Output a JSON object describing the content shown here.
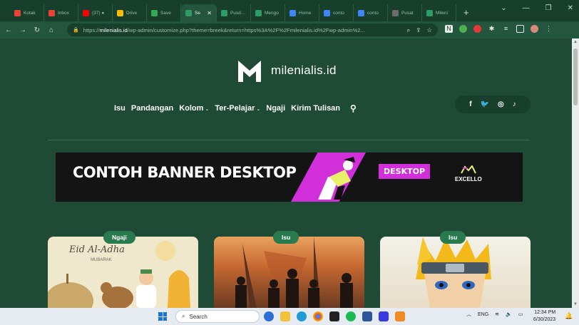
{
  "browser": {
    "tabs": [
      {
        "label": "Kotak",
        "color": "#ea4335"
      },
      {
        "label": "Inbox",
        "color": "#ea4335"
      },
      {
        "label": "(37) ●",
        "color": "#ff0000"
      },
      {
        "label": "Drive",
        "color": "#fbbc04"
      },
      {
        "label": "Save",
        "color": "#34a853"
      },
      {
        "label": "Se",
        "color": "#2f9b64",
        "active": true
      },
      {
        "label": "Pusdan",
        "color": "#2f9b64"
      },
      {
        "label": "Mengo",
        "color": "#2f9b64"
      },
      {
        "label": "Home",
        "color": "#4285f4"
      },
      {
        "label": "conto",
        "color": "#4285f4"
      },
      {
        "label": "conto",
        "color": "#4285f4"
      },
      {
        "label": "Pusat",
        "color": "#6b6b6b"
      },
      {
        "label": "Mileni",
        "color": "#2f9b64"
      }
    ],
    "url_prefix": "https://",
    "url_host": "milenialis.id",
    "url_path": "/wp-admin/customize.php?theme=breek&return=https%3A%2F%2Fmilenialis.id%2Fwp-admin%2..."
  },
  "site": {
    "brand": "milenialis.id",
    "menu": [
      {
        "label": "Isu",
        "dropdown": false
      },
      {
        "label": "Pandangan",
        "dropdown": false
      },
      {
        "label": "Kolom",
        "dropdown": true
      },
      {
        "label": "Ter-Pelajar",
        "dropdown": true
      },
      {
        "label": "Ngaji",
        "dropdown": false
      },
      {
        "label": "Kirim Tulisan",
        "dropdown": false
      }
    ],
    "social_icons": [
      "facebook-icon",
      "twitter-icon",
      "instagram-icon",
      "tiktok-icon"
    ]
  },
  "banner": {
    "headline": "CONTOH BANNER DESKTOP",
    "tag": "DESKTOP",
    "sponsor": "EXCELLO"
  },
  "cards": [
    {
      "category": "Ngaji",
      "image_text": "Eid Al-Adha",
      "image_subtext": "MUBARAK"
    },
    {
      "category": "Isu"
    },
    {
      "category": "Isu"
    }
  ],
  "taskbar": {
    "search_label": "Search",
    "language": "ENG",
    "time": "12:34 PM",
    "date": "6/30/2023"
  }
}
